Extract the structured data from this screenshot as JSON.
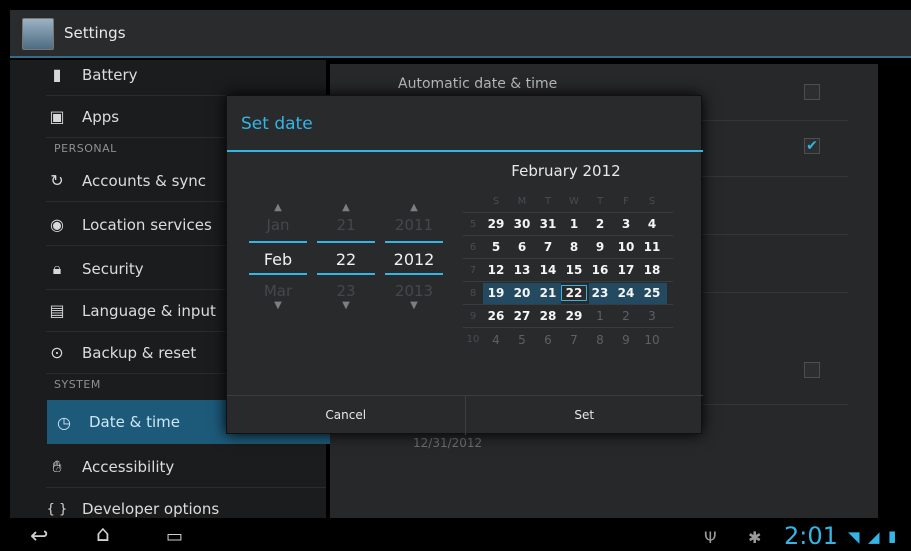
{
  "app": {
    "title": "Settings"
  },
  "sidebar": {
    "items": [
      {
        "label": "Battery",
        "icon": "battery-icon"
      },
      {
        "label": "Apps",
        "icon": "apps-icon"
      },
      {
        "label": "Accounts & sync",
        "icon": "sync-icon"
      },
      {
        "label": "Location services",
        "icon": "location-icon"
      },
      {
        "label": "Security",
        "icon": "lock-icon"
      },
      {
        "label": "Language & input",
        "icon": "keyboard-icon"
      },
      {
        "label": "Backup & reset",
        "icon": "backup-icon"
      },
      {
        "label": "Date & time",
        "icon": "clock-icon"
      },
      {
        "label": "Accessibility",
        "icon": "hand-icon"
      },
      {
        "label": "Developer options",
        "icon": "braces-icon"
      }
    ],
    "headers": {
      "personal": "PERSONAL",
      "system": "SYSTEM"
    },
    "selected": "Date & time"
  },
  "main": {
    "automatic_label": "Automatic date & time",
    "date_value": "12/31/2012",
    "checkbox_checked": true
  },
  "dialog": {
    "title": "Set date",
    "spinners": {
      "month": {
        "prev": "Jan",
        "current": "Feb",
        "next": "Mar"
      },
      "day": {
        "prev": "21",
        "current": "22",
        "next": "23"
      },
      "year": {
        "prev": "2011",
        "current": "2012",
        "next": "2013"
      }
    },
    "calendar": {
      "title": "February 2012",
      "day_names": [
        "S",
        "M",
        "T",
        "W",
        "T",
        "F",
        "S"
      ],
      "weeks": [
        {
          "num": "5",
          "days": [
            "29",
            "30",
            "31",
            "1",
            "2",
            "3",
            "4"
          ]
        },
        {
          "num": "6",
          "days": [
            "5",
            "6",
            "7",
            "8",
            "9",
            "10",
            "11"
          ]
        },
        {
          "num": "7",
          "days": [
            "12",
            "13",
            "14",
            "15",
            "16",
            "17",
            "18"
          ]
        },
        {
          "num": "8",
          "days": [
            "19",
            "20",
            "21",
            "22",
            "23",
            "24",
            "25"
          ]
        },
        {
          "num": "9",
          "days": [
            "26",
            "27",
            "28",
            "29",
            "1",
            "2",
            "3"
          ]
        },
        {
          "num": "10",
          "days": [
            "4",
            "5",
            "6",
            "7",
            "8",
            "9",
            "10"
          ]
        }
      ]
    },
    "cancel_label": "Cancel",
    "set_label": "Set"
  },
  "statusbar": {
    "time": "2:01"
  },
  "colors": {
    "accent": "#35b5e5",
    "selected": "#1d5a7a"
  }
}
